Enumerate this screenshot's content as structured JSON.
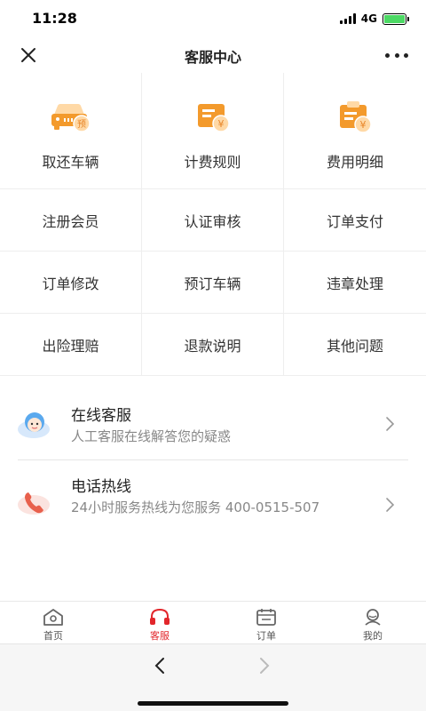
{
  "status": {
    "time": "11:28",
    "network": "4G"
  },
  "nav": {
    "title": "客服中心"
  },
  "grid": {
    "top_row": [
      {
        "label": "取还车辆",
        "icon": "car-reserve-icon"
      },
      {
        "label": "计费规则",
        "icon": "billing-card-icon"
      },
      {
        "label": "费用明细",
        "icon": "clipboard-fee-icon"
      }
    ],
    "rows": [
      [
        "注册会员",
        "认证审核",
        "订单支付"
      ],
      [
        "订单修改",
        "预订车辆",
        "违章处理"
      ],
      [
        "出险理赔",
        "退款说明",
        "其他问题"
      ]
    ]
  },
  "services": [
    {
      "title": "在线客服",
      "desc": "人工客服在线解答您的疑惑",
      "icon": "customer-service-avatar-icon"
    },
    {
      "title": "电话热线",
      "desc": "24小时服务热线为您服务 400-0515-507",
      "icon": "phone-icon"
    }
  ],
  "tabs": [
    {
      "label": "首页",
      "icon": "home-icon",
      "active": false
    },
    {
      "label": "客服",
      "icon": "headset-icon",
      "active": true
    },
    {
      "label": "订单",
      "icon": "calendar-order-icon",
      "active": false
    },
    {
      "label": "我的",
      "icon": "profile-icon",
      "active": false
    }
  ],
  "colors": {
    "accent": "#e2262b",
    "icon_orange": "#f39a2c",
    "icon_light": "#ffd9a6"
  }
}
